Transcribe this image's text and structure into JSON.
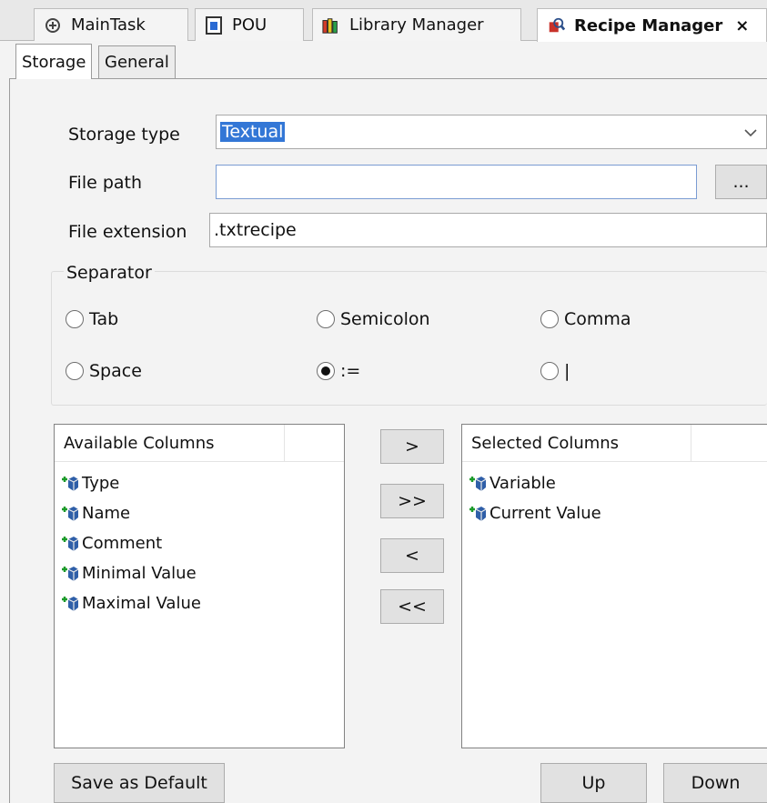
{
  "editor_tabs": [
    {
      "label": "MainTask",
      "icon": "task-icon"
    },
    {
      "label": "POU",
      "icon": "pou-icon"
    },
    {
      "label": "Library Manager",
      "icon": "library-icon"
    },
    {
      "label": "Recipe Manager",
      "icon": "recipe-icon",
      "close": "×"
    }
  ],
  "inner_tabs": [
    "Storage",
    "General"
  ],
  "form": {
    "storage_type_label": "Storage type",
    "storage_type_value": "Textual",
    "file_path_label": "File path",
    "file_path_value": "",
    "browse_label": "...",
    "file_extension_label": "File extension",
    "file_extension_value": ".txtrecipe"
  },
  "separator": {
    "title": "Separator",
    "options": [
      {
        "label": "Tab",
        "checked": false
      },
      {
        "label": "Semicolon",
        "checked": false
      },
      {
        "label": "Comma",
        "checked": false
      },
      {
        "label": "Space",
        "checked": false
      },
      {
        "label": ":=",
        "checked": true
      },
      {
        "label": "|",
        "checked": false
      }
    ]
  },
  "available": {
    "header": "Available Columns",
    "items": [
      "Type",
      "Name",
      "Comment",
      "Minimal Value",
      "Maximal Value"
    ]
  },
  "selected": {
    "header": "Selected Columns",
    "items": [
      "Variable",
      "Current Value"
    ]
  },
  "move_buttons": {
    "add": ">",
    "add_all": ">>",
    "remove": "<",
    "remove_all": "<<"
  },
  "bottom_buttons": {
    "save_default": "Save as Default",
    "up": "Up",
    "down": "Down"
  }
}
